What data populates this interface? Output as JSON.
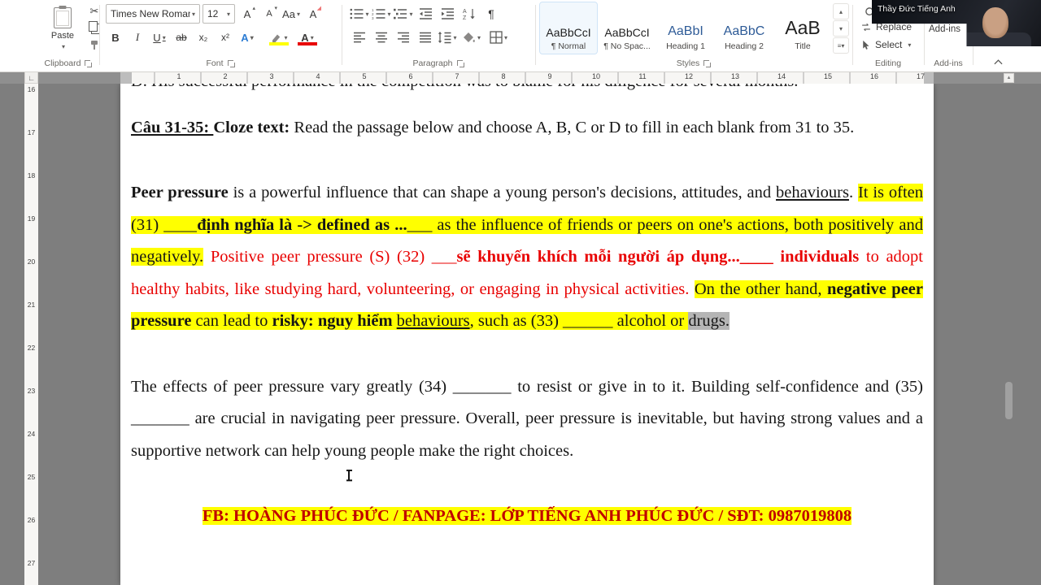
{
  "ribbon": {
    "clipboard": {
      "paste": "Paste",
      "label": "Clipboard"
    },
    "font": {
      "family": "Times New Roman",
      "size": "12",
      "label": "Font"
    },
    "paragraph": {
      "label": "Paragraph"
    },
    "styles": {
      "label": "Styles",
      "items": [
        {
          "preview": "AaBbCcI",
          "name": "¶ Normal"
        },
        {
          "preview": "AaBbCcI",
          "name": "¶ No Spac..."
        },
        {
          "preview": "AaBbI",
          "name": "Heading 1"
        },
        {
          "preview": "AaBbC",
          "name": "Heading 2"
        },
        {
          "preview": "AaB",
          "name": "Title"
        }
      ]
    },
    "editing": {
      "label": "Editing",
      "replace": "Replace",
      "select": "Select"
    },
    "addins": {
      "label": "Add-ins",
      "button": "Add-ins"
    },
    "glyphs": {
      "bold": "B",
      "italic": "I",
      "underline": "U",
      "strike": "ab",
      "sub": "x₂",
      "sup": "x²",
      "case": "Aa",
      "clear": "A",
      "grow": "A",
      "shrink": "A",
      "effects": "A",
      "fontcolor": "A",
      "pilcrow": "¶",
      "cut": "✂",
      "tab_selector": "∟"
    }
  },
  "webcam": {
    "name": "Thầy Đức Tiếng Anh"
  },
  "rulers": {
    "h": [
      "1",
      "2",
      "3",
      "4",
      "5",
      "6",
      "7",
      "8",
      "9",
      "10",
      "11",
      "12",
      "13",
      "14",
      "15",
      "16",
      "17"
    ],
    "v": [
      "16",
      "17",
      "18",
      "19",
      "20",
      "21",
      "22",
      "23",
      "24",
      "25",
      "26",
      "27"
    ]
  },
  "colors": {
    "highlight": "#ffff00",
    "red_text": "#e80000",
    "footer_red": "#c00000",
    "selection": "#b5b5b5"
  },
  "document": {
    "paragraphs": [
      {
        "id": "clipped-top-line",
        "cls": "first tight",
        "runs": [
          {
            "t": "D. His successful performance in the competition was to blame for his diligence for several months.",
            "f": ""
          }
        ]
      },
      {
        "id": "question-heading",
        "cls": "",
        "runs": [
          {
            "t": "Câu 31-35: ",
            "f": "bu"
          },
          {
            "t": "Cloze text: ",
            "f": "b"
          },
          {
            "t": "Read the passage below and choose A, B, C or D to fill in each blank from 31 to 35.",
            "f": ""
          }
        ]
      },
      {
        "id": "cloze-passage",
        "cls": "",
        "runs": [
          {
            "t": "Peer pressure",
            "f": "b"
          },
          {
            "t": " is a powerful influence that can shape a young person's decisions, attitudes, and ",
            "f": ""
          },
          {
            "t": "behaviours",
            "f": "u"
          },
          {
            "t": ". ",
            "f": ""
          },
          {
            "t": "It is often (31) ____",
            "f": "h"
          },
          {
            "t": "định nghĩa là -> defined as ...",
            "f": "bh"
          },
          {
            "t": "___ as the influence of friends or peers on one's actions, both positively and negatively.",
            "f": "h"
          },
          {
            "t": " ",
            "f": ""
          },
          {
            "t": "Positive peer pressure (S) (32) ___",
            "f": "r"
          },
          {
            "t": "sẽ khuyến khích mỗi người áp dụng...",
            "f": "br"
          },
          {
            "t": "____ ",
            "f": "br"
          },
          {
            "t": "individuals",
            "f": "br"
          },
          {
            "t": " to adopt healthy habits, like studying hard, volunteering, or engaging in physical activities. ",
            "f": "r"
          },
          {
            "t": "On the other hand, ",
            "f": "h"
          },
          {
            "t": "negative peer pressure",
            "f": "bh"
          },
          {
            "t": " can lead to ",
            "f": "h"
          },
          {
            "t": "risky: nguy hiểm",
            "f": "bh"
          },
          {
            "t": " ",
            "f": "h"
          },
          {
            "t": "behaviours",
            "f": "hu"
          },
          {
            "t": ", such as (33) ______ alcohol or ",
            "f": "h"
          },
          {
            "t": "drugs.",
            "f": "hs"
          }
        ]
      },
      {
        "id": "effects-paragraph",
        "cls": "",
        "runs": [
          {
            "t": "The effects of peer pressure vary greatly (34) _______ to resist or give in to it. Building self-confidence and (35) _______ are crucial in navigating peer pressure. Overall, peer pressure is inevitable, but having strong values and a supportive network can help young people make the right choices.",
            "f": ""
          }
        ]
      },
      {
        "id": "footer-banner",
        "cls": "center",
        "runs": [
          {
            "t": "FB: HOÀNG PHÚC ĐỨC / FANPAGE: LỚP TIẾNG ANH PHÚC ĐỨC / SĐT: 0987019808",
            "f": "bmh"
          }
        ]
      }
    ]
  }
}
